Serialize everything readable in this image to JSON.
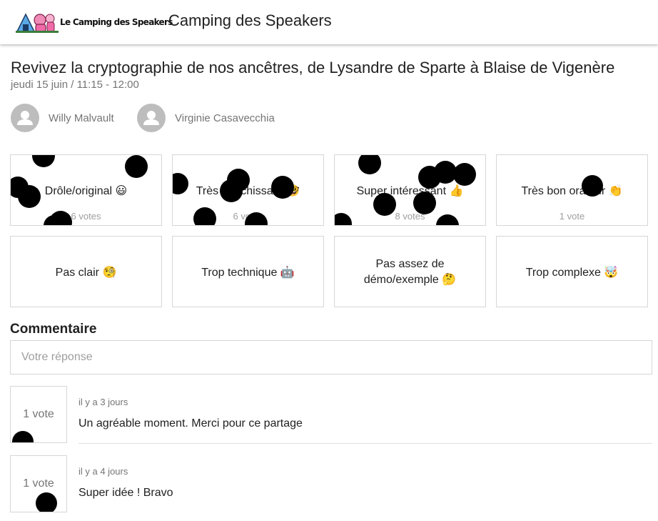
{
  "app": {
    "title": "Camping des Speakers",
    "logo_text": "Le Camping des Speakers",
    "accent": "#f06aa8"
  },
  "talk": {
    "title": "Revivez la cryptographie de nos ancêtres, de Lysandre de Sparte à Blaise de Vigenère",
    "schedule": "jeudi 15 juin / 11:15 - 12:00",
    "speakers": [
      {
        "name": "Willy Malvault",
        "icon": "person-icon"
      },
      {
        "name": "Virginie Casavecchia",
        "icon": "person-icon"
      }
    ]
  },
  "feedback": {
    "positive": [
      {
        "label": "Drôle/original 😃",
        "votes": "6 votes"
      },
      {
        "label": "Très enrichissant 🤓",
        "votes": "6 votes"
      },
      {
        "label": "Super intéressant 👍",
        "votes": "8 votes"
      },
      {
        "label": "Très bon orateur 👏",
        "votes": "1 vote"
      }
    ],
    "negative": [
      {
        "label": "Pas clair 🧐"
      },
      {
        "label": "Trop technique 🤖"
      },
      {
        "label_line1": "Pas assez de",
        "label_line2": "démo/exemple 🤔"
      },
      {
        "label": "Trop complexe 🤯"
      }
    ]
  },
  "comments": {
    "heading": "Commentaire",
    "placeholder": "Votre réponse",
    "items": [
      {
        "votes": "1 vote",
        "time": "il y a 3 jours",
        "text": "Un agréable moment. Merci pour ce partage"
      },
      {
        "votes": "1 vote",
        "time": "il y a 4 jours",
        "text": "Super idée ! Bravo"
      }
    ]
  }
}
